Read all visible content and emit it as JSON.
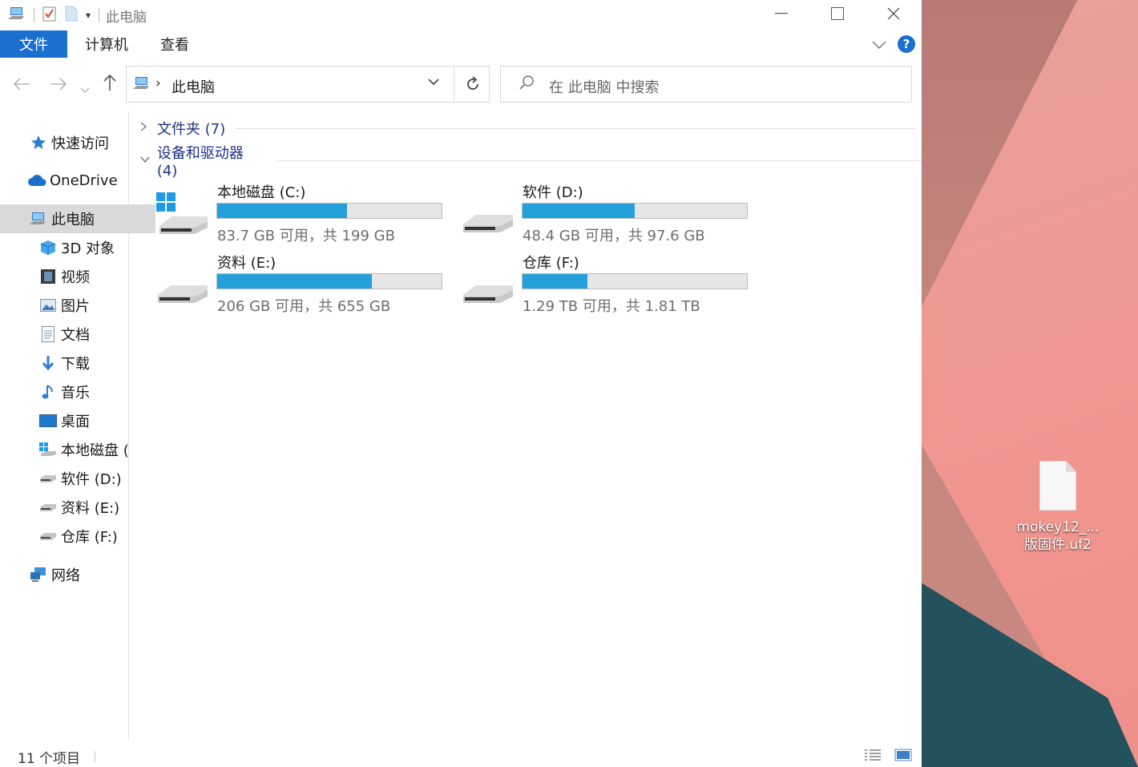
{
  "window": {
    "title": "此电脑",
    "controls": {
      "minimize": "—",
      "maximize": "☐",
      "close": "✕"
    }
  },
  "ribbon": {
    "tabs": [
      "文件",
      "计算机",
      "查看"
    ],
    "help": "?"
  },
  "address": {
    "path": "此电脑",
    "search_placeholder": "在 此电脑 中搜索"
  },
  "sidebar": {
    "items": [
      {
        "label": "快速访问",
        "icon": "star-icon"
      },
      {
        "label": "OneDrive",
        "icon": "cloud-icon"
      },
      {
        "label": "此电脑",
        "icon": "computer-icon",
        "selected": true
      },
      {
        "label": "3D 对象",
        "icon": "cube-icon"
      },
      {
        "label": "视频",
        "icon": "film-icon"
      },
      {
        "label": "图片",
        "icon": "picture-icon"
      },
      {
        "label": "文档",
        "icon": "document-icon"
      },
      {
        "label": "下载",
        "icon": "download-icon"
      },
      {
        "label": "音乐",
        "icon": "music-icon"
      },
      {
        "label": "桌面",
        "icon": "desktop-icon"
      },
      {
        "label": "本地磁盘 (",
        "icon": "windows-drive-icon"
      },
      {
        "label": "软件 (D:)",
        "icon": "drive-icon"
      },
      {
        "label": "资料 (E:)",
        "icon": "drive-icon"
      },
      {
        "label": "仓库 (F:)",
        "icon": "drive-icon"
      },
      {
        "label": "网络",
        "icon": "network-icon"
      }
    ]
  },
  "groups": {
    "folders": "文件夹 (7)",
    "devices": "设备和驱动器 (4)"
  },
  "drives": [
    {
      "name": "本地磁盘 (C:)",
      "free_text": "83.7 GB 可用，共 199 GB",
      "used_fraction": 0.58,
      "system": true
    },
    {
      "name": "软件 (D:)",
      "free_text": "48.4 GB 可用，共 97.6 GB",
      "used_fraction": 0.5,
      "system": false
    },
    {
      "name": "资料 (E:)",
      "free_text": "206 GB 可用，共 655 GB",
      "used_fraction": 0.69,
      "system": false
    },
    {
      "name": "仓库 (F:)",
      "free_text": "1.29 TB 可用，共 1.81 TB",
      "used_fraction": 0.29,
      "system": false
    }
  ],
  "status": {
    "count": "11 个项目"
  },
  "desktop": {
    "file_name_line1": "mokey12_...",
    "file_name_line2": "版固件.uf2"
  },
  "colors": {
    "accent": "#1a6fcf",
    "bar_fill": "#26a0da",
    "group_text": "#1e3287"
  }
}
